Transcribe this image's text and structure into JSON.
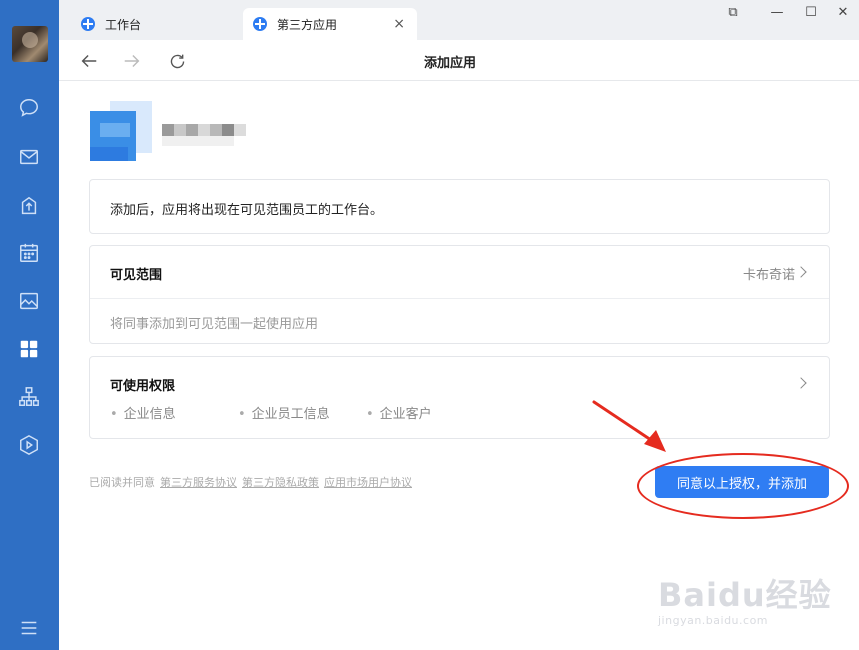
{
  "tabs": [
    {
      "label": "工作台"
    },
    {
      "label": "第三方应用",
      "close": "×"
    }
  ],
  "window_controls": {
    "restore": "⧉",
    "minimize": "—",
    "maximize": "☐",
    "close": "✕"
  },
  "nav": {
    "title": "添加应用"
  },
  "info": {
    "text": "添加后，应用将出现在可见范围员工的工作台。"
  },
  "visibility": {
    "title": "可见范围",
    "value": "卡布奇诺",
    "hint": "将同事添加到可见范围一起使用应用"
  },
  "permissions": {
    "title": "可使用权限",
    "items": [
      "企业信息",
      "企业员工信息",
      "企业客户"
    ]
  },
  "agreement": {
    "prefix": "已阅读并同意",
    "links": [
      "第三方服务协议",
      "第三方隐私政策",
      "应用市场用户协议"
    ]
  },
  "cta": {
    "label": "同意以上授权，并添加"
  },
  "watermark": {
    "brand": "Baidu经验",
    "url": "jingyan.baidu.com"
  },
  "colors": {
    "sidebar": "#2f6fc4",
    "accent": "#2f7df3",
    "annotation": "#e52b1f"
  },
  "icons": [
    "chat-icon",
    "mail-icon",
    "upload-icon",
    "calendar-icon",
    "image-icon",
    "apps-icon",
    "org-chart-icon",
    "hexagon-play-icon",
    "menu-icon"
  ]
}
